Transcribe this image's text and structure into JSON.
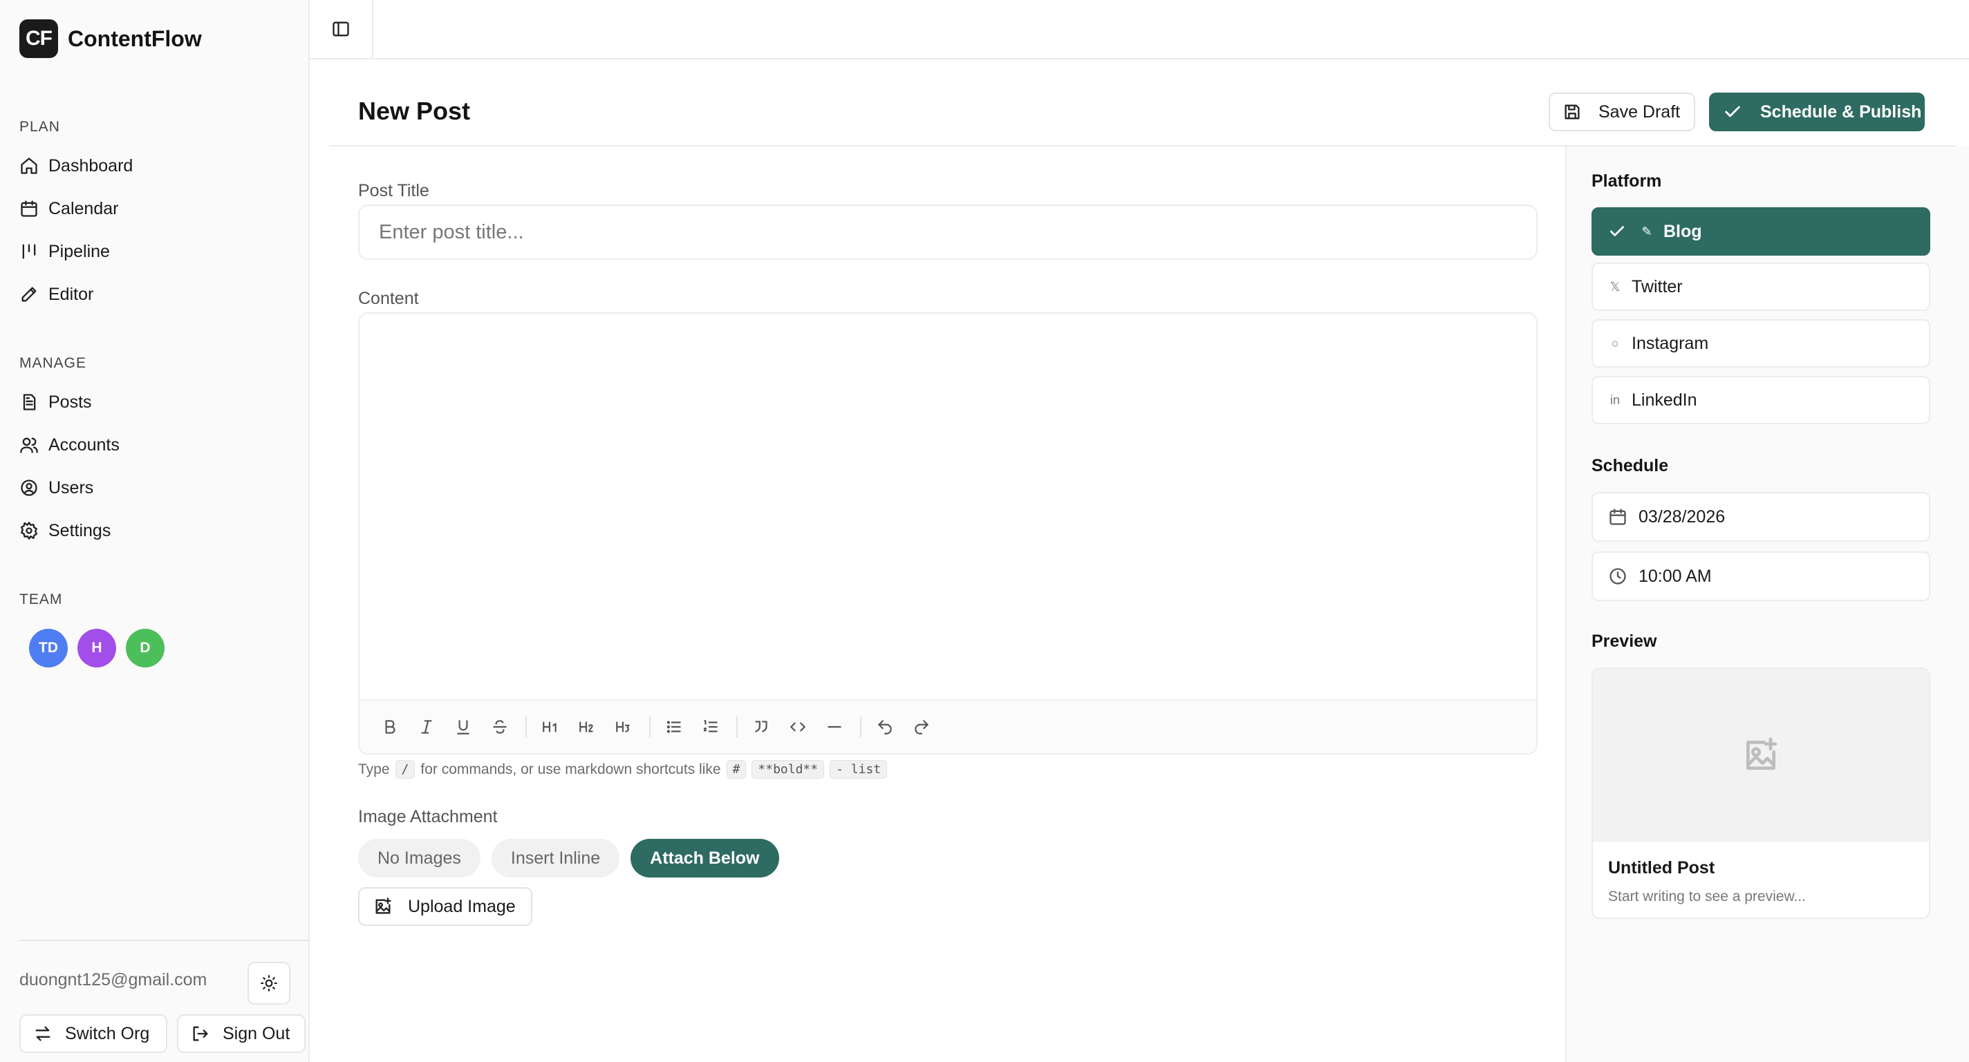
{
  "brand": {
    "logo_text": "CF",
    "name": "ContentFlow"
  },
  "sidebar": {
    "sections": {
      "plan": "PLAN",
      "manage": "MANAGE",
      "team": "TEAM"
    },
    "plan_items": [
      {
        "label": "Dashboard",
        "icon": "home-icon"
      },
      {
        "label": "Calendar",
        "icon": "calendar-icon"
      },
      {
        "label": "Pipeline",
        "icon": "pipeline-icon"
      },
      {
        "label": "Editor",
        "icon": "edit-icon"
      }
    ],
    "manage_items": [
      {
        "label": "Posts",
        "icon": "file-icon"
      },
      {
        "label": "Accounts",
        "icon": "users-icon"
      },
      {
        "label": "Users",
        "icon": "user-circle-icon"
      },
      {
        "label": "Settings",
        "icon": "gear-icon"
      }
    ],
    "team": [
      {
        "initials": "TD",
        "color": "#4f7df2"
      },
      {
        "initials": "H",
        "color": "#a24ee8"
      },
      {
        "initials": "D",
        "color": "#4cbf5a"
      }
    ],
    "footer": {
      "email": "duongnt125@gmail.com",
      "switch_org": "Switch Org",
      "sign_out": "Sign Out"
    }
  },
  "header": {
    "page_title": "New Post",
    "save_draft": "Save Draft",
    "publish": "Schedule & Publish"
  },
  "editor": {
    "title_label": "Post Title",
    "title_placeholder": "Enter post title...",
    "content_label": "Content",
    "toolbar": [
      "B",
      "I",
      "U",
      "S",
      "H1",
      "H2",
      "H3",
      "bullet-list",
      "ordered-list",
      "quote",
      "code",
      "divider",
      "undo",
      "redo"
    ],
    "hint": {
      "prefix": "Type",
      "slash": "/",
      "middle": "for commands, or use markdown shortcuts like",
      "hash": "#",
      "bold": "**bold**",
      "list": "- list"
    },
    "image_attachment_label": "Image Attachment",
    "attachment_options": [
      "No Images",
      "Insert Inline",
      "Attach Below"
    ],
    "attachment_selected": "Attach Below",
    "upload_label": "Upload Image"
  },
  "platform": {
    "heading": "Platform",
    "items": [
      {
        "label": "Blog",
        "glyph": "✎",
        "selected": true
      },
      {
        "label": "Twitter",
        "glyph": "𝕏",
        "selected": false
      },
      {
        "label": "Instagram",
        "glyph": "○",
        "selected": false
      },
      {
        "label": "LinkedIn",
        "glyph": "in",
        "selected": false
      }
    ]
  },
  "schedule": {
    "heading": "Schedule",
    "date": "03/28/2026",
    "time": "10:00 AM"
  },
  "preview": {
    "heading": "Preview",
    "title": "Untitled Post",
    "subtitle": "Start writing to see a preview..."
  },
  "colors": {
    "accent": "#2e6b62",
    "sidebar_bg": "#fafafa",
    "border": "#ececec"
  }
}
